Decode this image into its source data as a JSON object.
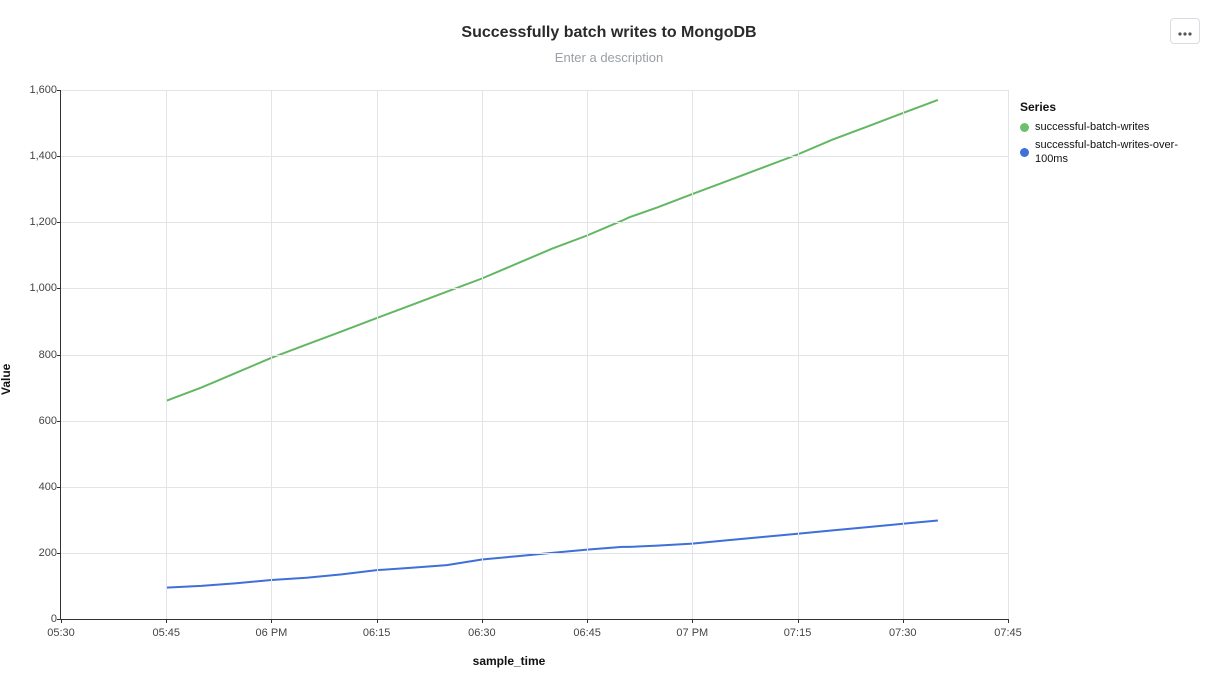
{
  "header": {
    "title": "Successfully batch writes to MongoDB",
    "description_placeholder": "Enter a description"
  },
  "legend": {
    "title": "Series",
    "items": [
      {
        "label": "successful-batch-writes",
        "color": "#6cbf6c"
      },
      {
        "label": "successful-batch-writes-over-100ms",
        "color": "#3f6fd8"
      }
    ]
  },
  "axes": {
    "y_label": "Value",
    "x_label": "sample_time"
  },
  "colors": {
    "series1": "#62b862",
    "series2": "#3f6fd8",
    "grid": "#e2e4e8"
  },
  "chart_data": {
    "type": "line",
    "xlabel": "sample_time",
    "ylabel": "Value",
    "ylim": [
      0,
      1600
    ],
    "xlim": [
      "05:30",
      "07:45"
    ],
    "x_ticks": [
      "05:30",
      "05:45",
      "06 PM",
      "06:15",
      "06:30",
      "06:45",
      "07 PM",
      "07:15",
      "07:30",
      "07:45"
    ],
    "y_ticks": [
      0,
      200,
      400,
      600,
      800,
      1000,
      1200,
      1400,
      1600
    ],
    "x": [
      "05:45",
      "05:50",
      "05:55",
      "06:00",
      "06:05",
      "06:10",
      "06:15",
      "06:20",
      "06:25",
      "06:30",
      "06:35",
      "06:40",
      "06:45",
      "06:50",
      "06:51",
      "06:55",
      "07:00",
      "07:05",
      "07:10",
      "07:15",
      "07:20",
      "07:25",
      "07:30",
      "07:35"
    ],
    "series": [
      {
        "name": "successful-batch-writes",
        "color": "#62b862",
        "values": [
          660,
          700,
          745,
          790,
          830,
          870,
          910,
          950,
          990,
          1030,
          1075,
          1120,
          1160,
          1205,
          1215,
          1245,
          1285,
          1325,
          1365,
          1405,
          1450,
          1490,
          1530,
          1570
        ]
      },
      {
        "name": "successful-batch-writes-over-100ms",
        "color": "#3f6fd8",
        "values": [
          95,
          100,
          108,
          118,
          125,
          135,
          148,
          155,
          163,
          180,
          190,
          200,
          210,
          218,
          218,
          222,
          228,
          238,
          248,
          258,
          268,
          278,
          288,
          298
        ]
      }
    ]
  }
}
